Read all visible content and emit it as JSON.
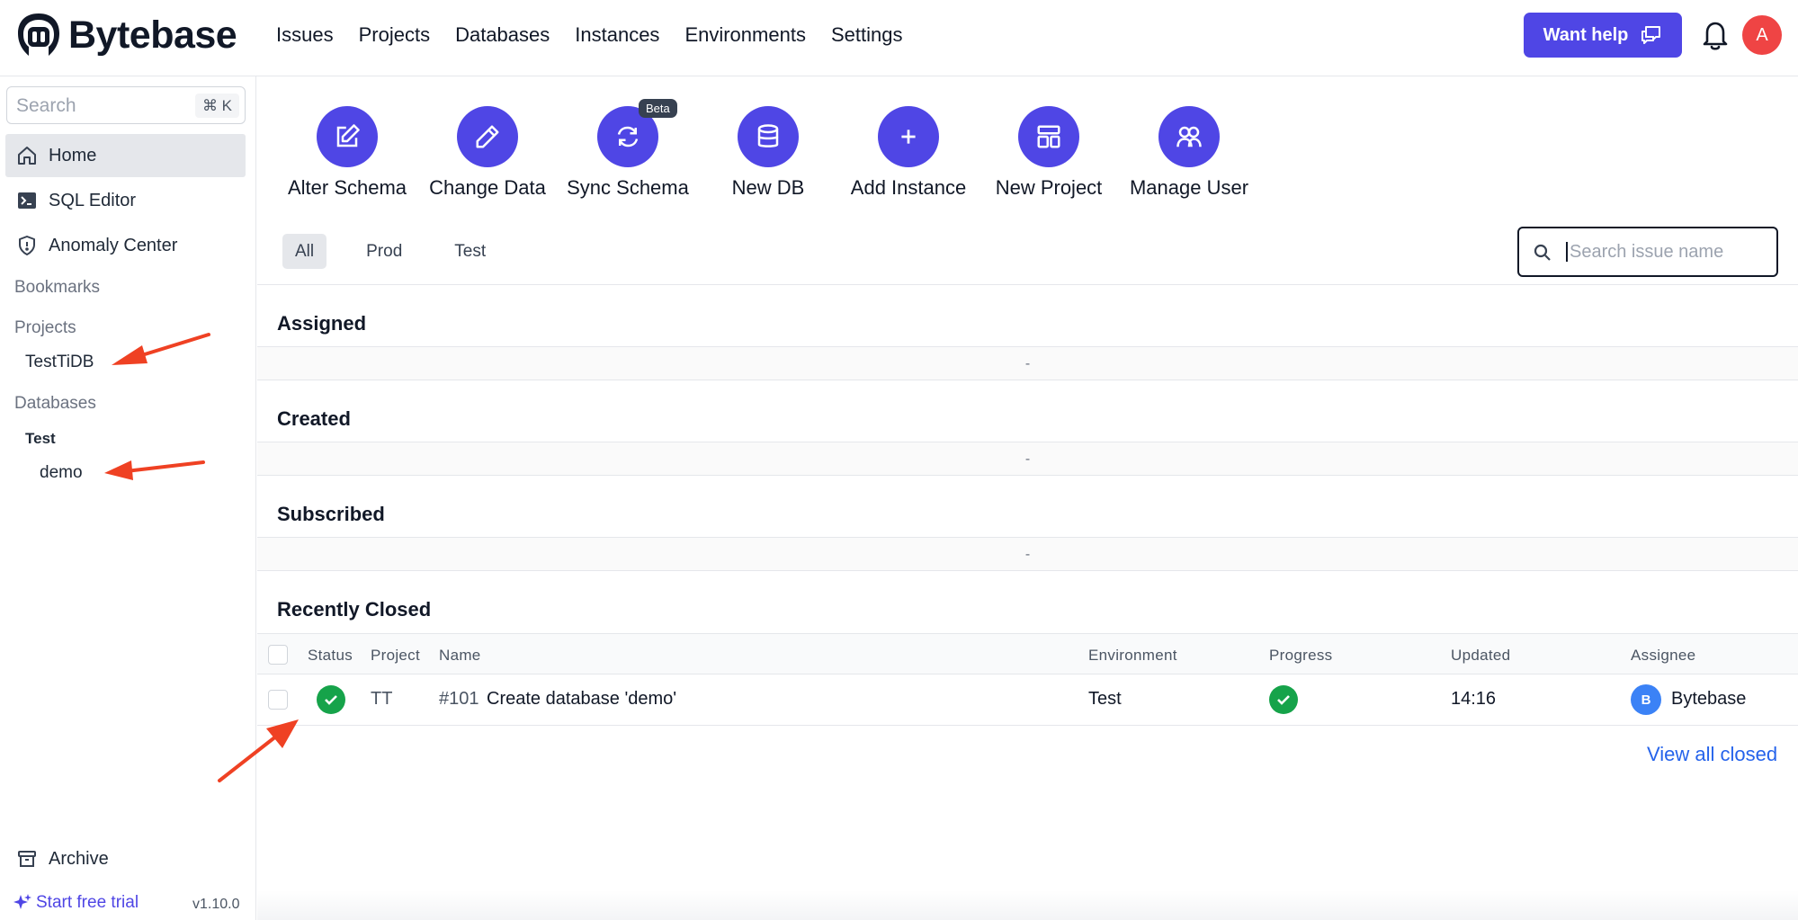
{
  "brand": {
    "name": "Bytebase"
  },
  "nav": {
    "items": [
      "Issues",
      "Projects",
      "Databases",
      "Instances",
      "Environments",
      "Settings"
    ]
  },
  "header": {
    "help_label": "Want help",
    "avatar_initial": "A"
  },
  "sidebar": {
    "search_placeholder": "Search",
    "search_shortcut": "⌘ K",
    "items": [
      {
        "label": "Home",
        "icon": "home-icon",
        "active": true
      },
      {
        "label": "SQL Editor",
        "icon": "terminal-icon"
      },
      {
        "label": "Anomaly Center",
        "icon": "shield-icon"
      }
    ],
    "bookmarks_label": "Bookmarks",
    "projects_label": "Projects",
    "projects": [
      "TestTiDB"
    ],
    "databases_label": "Databases",
    "db_group": "Test",
    "databases": [
      "demo"
    ],
    "archive_label": "Archive",
    "trial_label": "Start free trial",
    "version": "v1.10.0"
  },
  "quick_actions": [
    {
      "label": "Alter Schema",
      "icon": "edit-icon"
    },
    {
      "label": "Change Data",
      "icon": "pencil-icon"
    },
    {
      "label": "Sync Schema",
      "icon": "sync-icon",
      "badge": "Beta"
    },
    {
      "label": "New DB",
      "icon": "database-icon"
    },
    {
      "label": "Add Instance",
      "icon": "plus-icon"
    },
    {
      "label": "New Project",
      "icon": "layout-icon"
    },
    {
      "label": "Manage User",
      "icon": "users-icon"
    }
  ],
  "env_tabs": [
    {
      "label": "All",
      "active": true
    },
    {
      "label": "Prod"
    },
    {
      "label": "Test"
    }
  ],
  "issue_search": {
    "placeholder": "Search issue name"
  },
  "sections": {
    "assigned": "Assigned",
    "created": "Created",
    "subscribed": "Subscribed",
    "recently_closed": "Recently Closed",
    "empty": "-"
  },
  "table": {
    "headers": [
      "Status",
      "Project",
      "Name",
      "Environment",
      "Progress",
      "Updated",
      "Assignee"
    ],
    "rows": [
      {
        "project": "TT",
        "id": "#101",
        "name": "Create database 'demo'",
        "environment": "Test",
        "updated": "14:16",
        "assignee_initial": "B",
        "assignee": "Bytebase"
      }
    ]
  },
  "view_all_label": "View all closed",
  "colors": {
    "accent": "#4f46e5",
    "success": "#16a34a",
    "annotation": "#ef4123",
    "avatar": "#ef4444"
  }
}
